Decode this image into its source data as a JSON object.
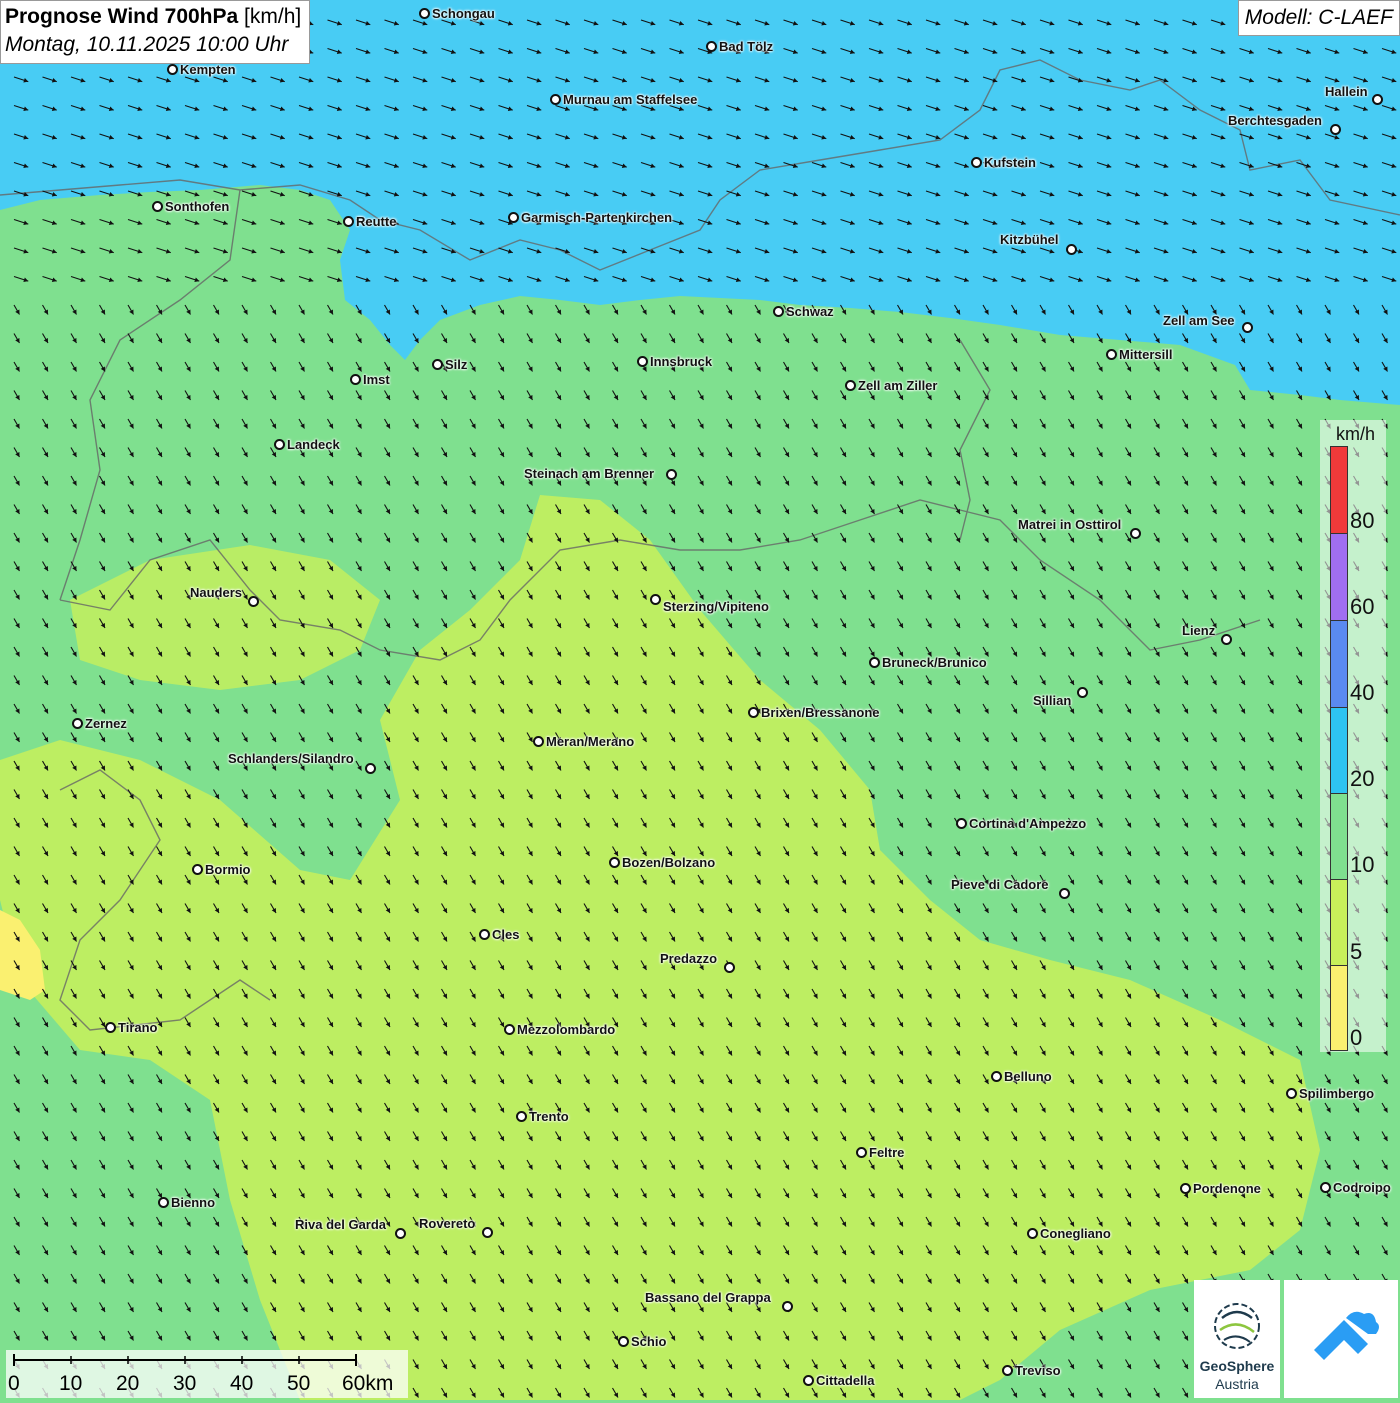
{
  "title": {
    "main": "Prognose Wind 700hPa",
    "unit": "[km/h]",
    "subtitle": "Montag, 10.11.2025 10:00 Uhr"
  },
  "model": "Modell: C-LAEF",
  "legend": {
    "unit": "km/h",
    "labels": [
      "80",
      "60",
      "40",
      "20",
      "10",
      "5",
      "0"
    ],
    "colors": [
      "#f03a3a",
      "#a06ef0",
      "#5a8af0",
      "#2ec4f2",
      "#7fe08f",
      "#c8f05a",
      "#faf070"
    ]
  },
  "scale_bar": {
    "labels": [
      "0",
      "10",
      "20",
      "30",
      "40",
      "50",
      "60km"
    ]
  },
  "logos": {
    "geosphere_line1": "GeoSphere",
    "geosphere_line2": "Austria"
  },
  "cities": [
    "Schongau",
    "Kempten",
    "Bad Tölz",
    "Murnau am Staffelsee",
    "Hallein",
    "Berchtesgaden",
    "Kufstein",
    "Sonthofen",
    "Reutte",
    "Garmisch-Partenkirchen",
    "Kitzbühel",
    "Schwaz",
    "Zell am See",
    "Mittersill",
    "Silz",
    "Innsbruck",
    "Imst",
    "Zell am Ziller",
    "Landeck",
    "Steinach am Brenner",
    "Matrei in Osttirol",
    "Nauders",
    "Sterzing/Vipiteno",
    "Lienz",
    "Bruneck/Brunico",
    "Sillian",
    "Brixen/Bressanone",
    "Zernez",
    "Meran/Merano",
    "Schlanders/Silandro",
    "Cortina d'Ampezzo",
    "Bozen/Bolzano",
    "Bormio",
    "Pieve di Cadore",
    "Cles",
    "Predazzo",
    "Tirano",
    "Mezzolombardo",
    "Belluno",
    "Spilimbergo",
    "Trento",
    "Feltre",
    "Bienno",
    "Pordenone",
    "Codroipo",
    "Riva del Garda",
    "Rovereto",
    "Conegliano",
    "Bassano del Grappa",
    "Schio",
    "Treviso",
    "Cittadella"
  ]
}
